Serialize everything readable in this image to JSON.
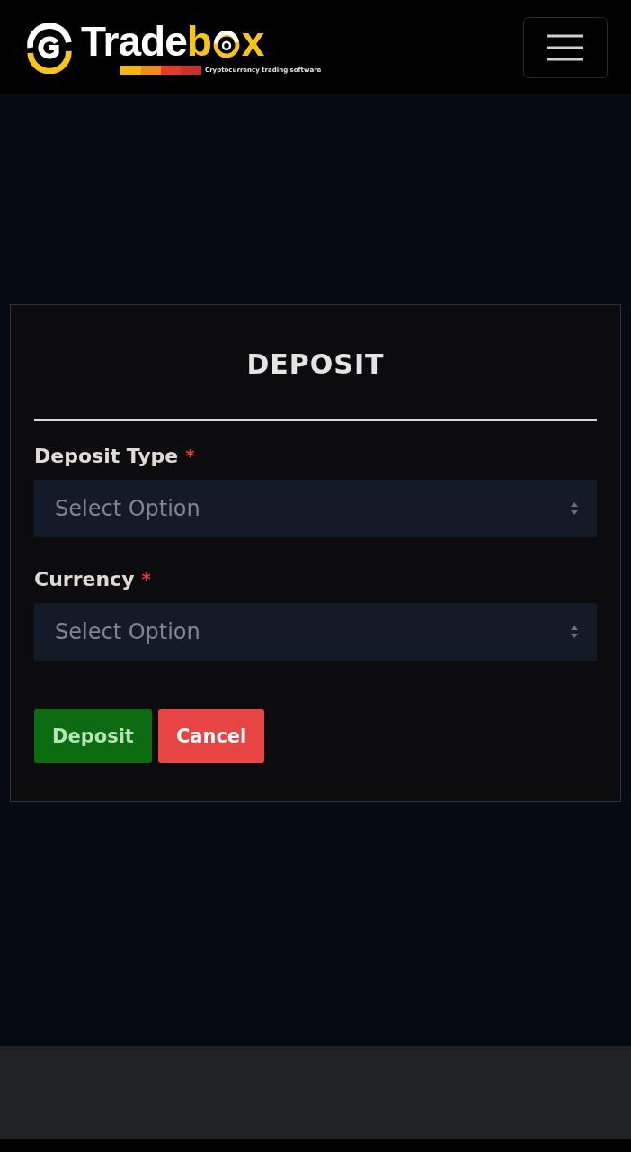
{
  "header": {
    "brand": {
      "name_start": "Trade",
      "name_middle": "b",
      "name_end": "x",
      "tagline": "Cryptocurrency trading software"
    }
  },
  "form": {
    "title": "DEPOSIT",
    "fields": [
      {
        "label": "Deposit Type",
        "required_mark": "*",
        "placeholder": "Select Option"
      },
      {
        "label": "Currency",
        "required_mark": "*",
        "placeholder": "Select Option"
      }
    ],
    "buttons": [
      {
        "kind": "primary",
        "label": "Deposit"
      },
      {
        "kind": "danger",
        "label": "Cancel"
      }
    ]
  }
}
